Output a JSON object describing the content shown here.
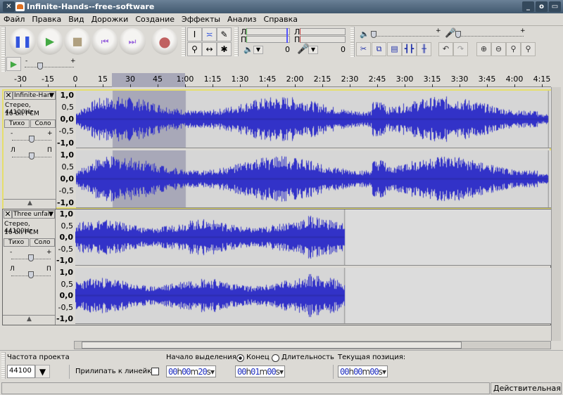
{
  "window": {
    "title": "Infinite-Hands--free-software",
    "controls": [
      "_",
      "o",
      "▭"
    ]
  },
  "menu": [
    "Файл",
    "Правка",
    "Вид",
    "Дорожки",
    "Создание",
    "Эффекты",
    "Анализ",
    "Справка"
  ],
  "meter": {
    "left": "Л",
    "right": "П",
    "zero1": "0",
    "zero2": "0"
  },
  "slider": {
    "minus": "-",
    "plus": "+"
  },
  "ruler": {
    "labels": [
      "-30",
      "-15",
      "0",
      "15",
      "30",
      "45",
      "1:00",
      "1:15",
      "1:30",
      "1:45",
      "2:00",
      "2:15",
      "2:30",
      "2:45",
      "3:00",
      "3:15",
      "3:30",
      "3:45",
      "4:00",
      "4:15"
    ],
    "selection_start_s": 20,
    "selection_end_s": 60
  },
  "tracks": [
    {
      "name": "Infinite-Han",
      "info1": "Стерео, 44100Hz",
      "info2": "16-bit PCM",
      "mute": "Тихо",
      "solo": "Соло",
      "gain_l": "-",
      "gain_r": "+",
      "pan_l": "Л",
      "pan_r": "П",
      "duration_s": 258,
      "selected": true
    },
    {
      "name": "Three unfair",
      "info1": "Стерео, 44100Hz",
      "info2": "16-bit PCM",
      "mute": "Тихо",
      "solo": "Соло",
      "gain_l": "-",
      "gain_r": "+",
      "pan_l": "Л",
      "pan_r": "П",
      "duration_s": 147,
      "selected": false
    }
  ],
  "vruler": [
    "1,0",
    "0,5",
    "0,0",
    "-0,5",
    "-1,0"
  ],
  "wave_color": "#3232c8",
  "bottom": {
    "rate_label": "Частота проекта",
    "rate_value": "44100",
    "snap_label": "Прилипать к линейке",
    "sel_start_label": "Начало выделения:",
    "end_label": "Конец",
    "length_label": "Длительность",
    "pos_label": "Текущая позиция:",
    "sel_start": [
      "00",
      "h",
      "00",
      "m",
      "20",
      "s"
    ],
    "sel_end": [
      "00",
      "h",
      "01",
      "m",
      "00",
      "s"
    ],
    "position": [
      "00",
      "h",
      "00",
      "m",
      "00",
      "s"
    ]
  },
  "status": {
    "right": "Действительная ч"
  }
}
